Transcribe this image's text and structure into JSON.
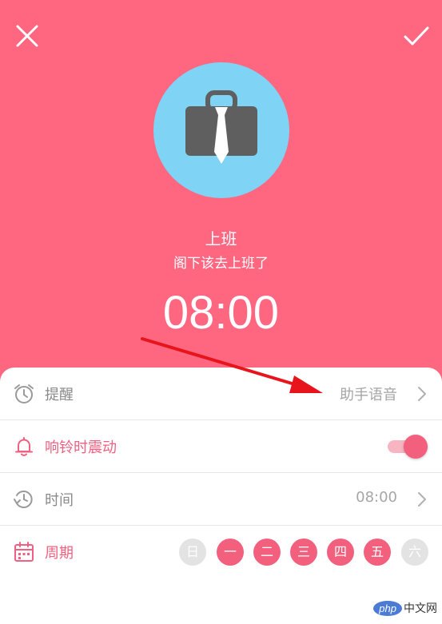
{
  "alarm": {
    "title": "上班",
    "subtitle": "阁下该去上班了",
    "time": "08:00"
  },
  "settings": {
    "reminder": {
      "label": "提醒",
      "value": "助手语音",
      "icon": "alarm-clock-icon"
    },
    "vibrate": {
      "label": "响铃时震动",
      "enabled": true,
      "icon": "bell-icon"
    },
    "time": {
      "label": "时间",
      "value": "08:00",
      "icon": "clock-refresh-icon"
    },
    "repeat": {
      "label": "周期",
      "icon": "calendar-icon",
      "days": [
        {
          "label": "日",
          "selected": false
        },
        {
          "label": "一",
          "selected": true
        },
        {
          "label": "二",
          "selected": true
        },
        {
          "label": "三",
          "selected": true
        },
        {
          "label": "四",
          "selected": true
        },
        {
          "label": "五",
          "selected": true
        },
        {
          "label": "六",
          "selected": false
        }
      ]
    }
  },
  "colors": {
    "background": "#ff6680",
    "accent": "#f2607e",
    "hero_circle": "#7fd3f5",
    "annotation": "#e8141b"
  },
  "watermark": {
    "logo": "php",
    "text": "中文网"
  }
}
